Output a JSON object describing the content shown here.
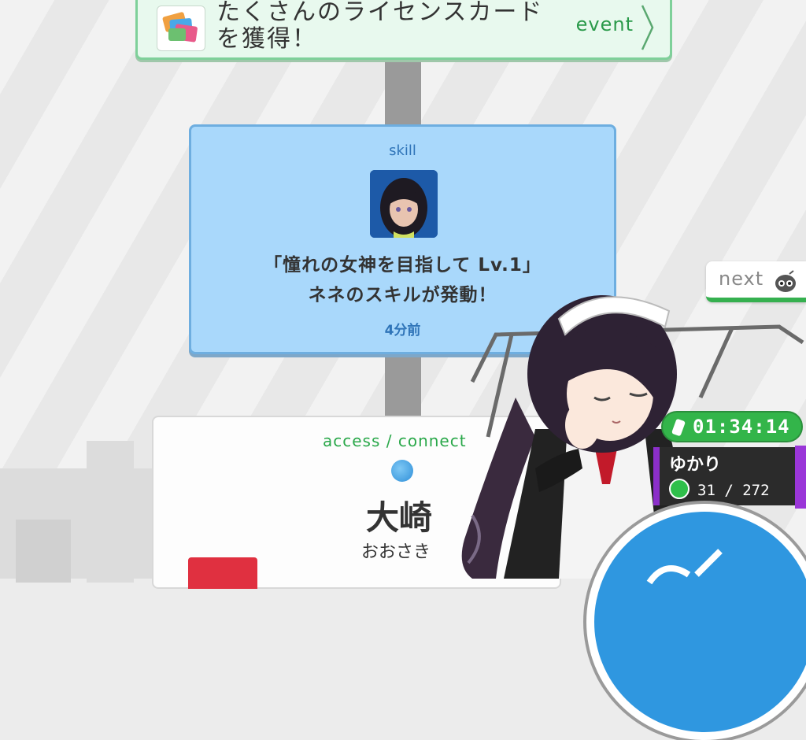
{
  "event": {
    "text": "たくさんのライセンスカードを獲得！",
    "tag": "event"
  },
  "skill": {
    "tag": "skill",
    "title": "「憧れの女神を目指して Lv.1」",
    "subtitle": "ネネのスキルが発動！",
    "time": "4分前"
  },
  "access": {
    "tag": "access / connect",
    "station_name": "大崎",
    "station_kana": "おおさき"
  },
  "next": {
    "label": "next"
  },
  "timer": {
    "value": "01:34:14"
  },
  "player": {
    "name": "ゆかり",
    "count": "31 / 272"
  },
  "colors": {
    "skill_card": "#a9d8fb",
    "event_card": "#e8f9ee",
    "accent_green": "#33b54a",
    "accent_purple": "#8b2fc9",
    "action_blue": "#2f97e0"
  }
}
